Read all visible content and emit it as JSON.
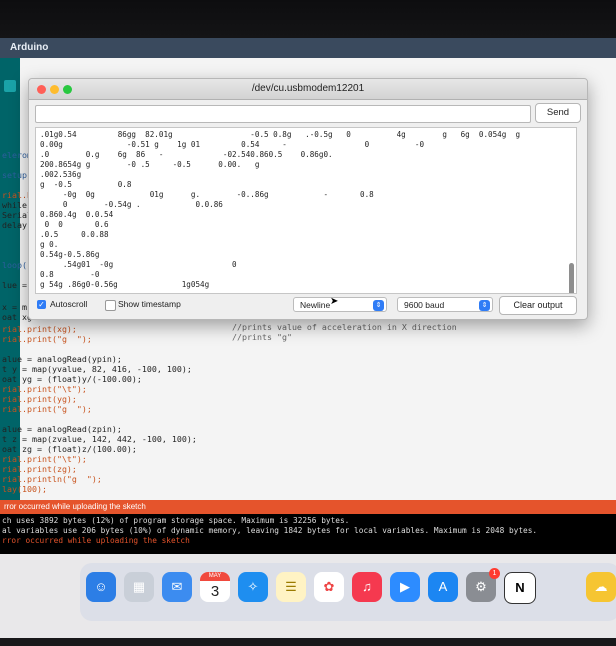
{
  "menubar": {
    "app_name": "Arduino"
  },
  "serial_monitor": {
    "title": "/dev/cu.usbmodem12201",
    "send_label": "Send",
    "input_value": "",
    "output_lines": [
      ".01g0.54         86gg  82.01g                 -0.5 0.8g   .-0.5g   0          4g        g   6g  0.054g  g",
      "0.00g              -0.51 g    1g 01         0.54     -                 0          -0",
      ".0        0.g    6g  86   -             -02.540.860.5    0.86g0.",
      "200.8654g g        -0 .5     -0.5      0.00.   g",
      ".002.536g",
      "g  -0.5          0.8",
      "     -0g  0g            01g      g.        -0..86g            -       0.8",
      "     0        -0.54g .            0.0.86",
      "0.860.4g  0.0.54",
      " 0  0       0.6",
      ".0.5     0.0.88",
      "g 0.",
      "0.54g-0.5.86g",
      "     .54g01  -0g                          0",
      "0.8        -0",
      "g 54g .86g0-0.56g              1g054g"
    ],
    "autoscroll_label": "Autoscroll",
    "timestamp_label": "Show timestamp",
    "line_ending": "Newline",
    "baud": "9600 baud",
    "clear_label": "Clear output"
  },
  "code": {
    "left_fragments": [
      "eleromo",
      "setup(",
      "rial.be",
      "while (",
      "Serial",
      "delay(",
      "loop()",
      "lue = ",
      "x = m",
      "oat xg"
    ],
    "lines": [
      "rial.print(xg);",
      "rial.print(\"g  \");",
      "",
      "alue = analogRead(ypin);",
      "t y = map(yvalue, 82, 416, -100, 100);",
      "oat yg = (float)y/(-100.00);",
      "rial.print(\"\\t\");",
      "rial.print(yg);",
      "rial.print(\"g  \");",
      "",
      "alue = analogRead(zpin);",
      "t z = map(zvalue, 142, 442, -100, 100);",
      "oat zg = (float)z/(100.00);",
      "rial.print(\"\\t\");",
      "rial.print(zg);",
      "rial.println(\"g  \");",
      "lay(100);"
    ],
    "comment1": "//prints value of acceleration in X direction",
    "comment2": "//prints \"g\""
  },
  "error_bar": {
    "text": "rror occurred while uploading the sketch"
  },
  "console": {
    "lines": [
      "ch uses 3892 bytes (12%) of program storage space. Maximum is 32256 bytes.",
      "al variables use 206 bytes (10%) of dynamic memory, leaving 1842 bytes for local variables. Maximum is 2048 bytes.",
      "rror occurred while uploading the sketch"
    ]
  },
  "dock": {
    "calendar_month": "MAY",
    "calendar_day": "3",
    "settings_badge": "1",
    "icons": [
      "finder-icon",
      "launchpad-icon",
      "mail-icon",
      "calendar-icon",
      "safari-icon",
      "notes-icon",
      "photos-icon",
      "music-icon",
      "zoom-icon",
      "app-store-icon",
      "system-settings-icon",
      "notion-icon",
      "weather-icon"
    ]
  }
}
